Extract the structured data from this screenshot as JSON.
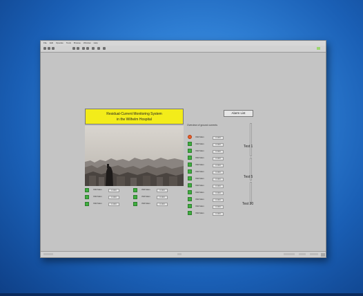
{
  "window": {
    "menu": [
      "File",
      "Edit",
      "Operate",
      "Tools",
      "Browse",
      "Window",
      "Help"
    ]
  },
  "panel": {
    "title_line1": "Residual-Current Monitoring System",
    "title_line2": "in the Wilhelm Hospital",
    "alarm_button": "Alarm List",
    "overview_label": "Overview of ground currents",
    "tests": [
      "Test 1",
      "Test 5",
      "Test 20"
    ]
  },
  "left_rows": [
    {
      "label": "ISM Main",
      "value": "0.000",
      "state": "ok"
    },
    {
      "label": "ISM Main",
      "value": "0.000",
      "state": "ok"
    },
    {
      "label": "ISM Main",
      "value": "0.000",
      "state": "ok"
    }
  ],
  "mid_rows": [
    {
      "label": "ISM Main",
      "value": "0.000",
      "state": "ok"
    },
    {
      "label": "ISM Main",
      "value": "0.000",
      "state": "ok"
    },
    {
      "label": "ISM Main",
      "value": "0.000",
      "state": "ok"
    }
  ],
  "right_rows": [
    {
      "label": "ISM Main",
      "value": "0.000",
      "state": "alarm"
    },
    {
      "label": "ISM Main",
      "value": "0.000",
      "state": "ok"
    },
    {
      "label": "ISM Main",
      "value": "0.000",
      "state": "ok"
    },
    {
      "label": "ISM Main",
      "value": "0.000",
      "state": "ok"
    },
    {
      "label": "ISM Main",
      "value": "0.000",
      "state": "ok"
    },
    {
      "label": "ISM Main",
      "value": "0.000",
      "state": "ok"
    },
    {
      "label": "ISM Main",
      "value": "0.000",
      "state": "ok"
    },
    {
      "label": "ISM Main",
      "value": "0.000",
      "state": "ok"
    },
    {
      "label": "ISM Main",
      "value": "0.000",
      "state": "ok"
    },
    {
      "label": "ISM Main",
      "value": "0.000",
      "state": "ok"
    },
    {
      "label": "ISM Main",
      "value": "0.000",
      "state": "ok"
    },
    {
      "label": "ISM Main",
      "value": "0.000",
      "state": "ok"
    }
  ],
  "colors": {
    "led_ok": "#3fae3f",
    "led_alarm": "#e85d2a",
    "title_bg": "#f3ec1a",
    "desktop": "#2f7fd4"
  },
  "icons": [
    "run-arrow-icon",
    "stop-icon",
    "pause-icon",
    "font-icon",
    "align-icon",
    "status-light-icon"
  ]
}
